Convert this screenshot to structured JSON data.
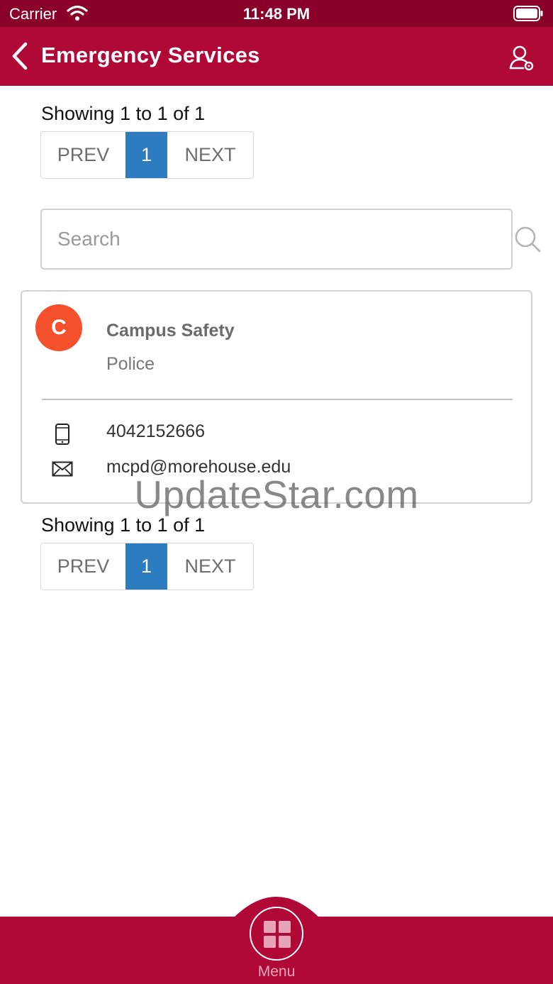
{
  "status_bar": {
    "carrier": "Carrier",
    "time": "11:48 PM"
  },
  "header": {
    "title": "Emergency Services",
    "back_icon": "chevron-left-icon",
    "profile_icon": "user-settings-icon"
  },
  "pagination_top": {
    "showing": "Showing 1 to 1 of 1",
    "prev": "PREV",
    "page": "1",
    "next": "NEXT"
  },
  "search": {
    "placeholder": "Search",
    "value": ""
  },
  "contacts": [
    {
      "initial": "C",
      "name": "Campus Safety",
      "type": "Police",
      "phone": "4042152666",
      "email": "mcpd@morehouse.edu"
    }
  ],
  "watermark": "UpdateStar.com",
  "pagination_bottom": {
    "showing": "Showing 1 to 1 of 1",
    "prev": "PREV",
    "page": "1",
    "next": "NEXT"
  },
  "bottom_nav": {
    "menu_label": "Menu",
    "menu_icon": "grid-icon"
  },
  "colors": {
    "brand": "#b00938",
    "status_bar": "#8a0028",
    "active_page": "#2e7cc0",
    "avatar": "#f4502b"
  }
}
